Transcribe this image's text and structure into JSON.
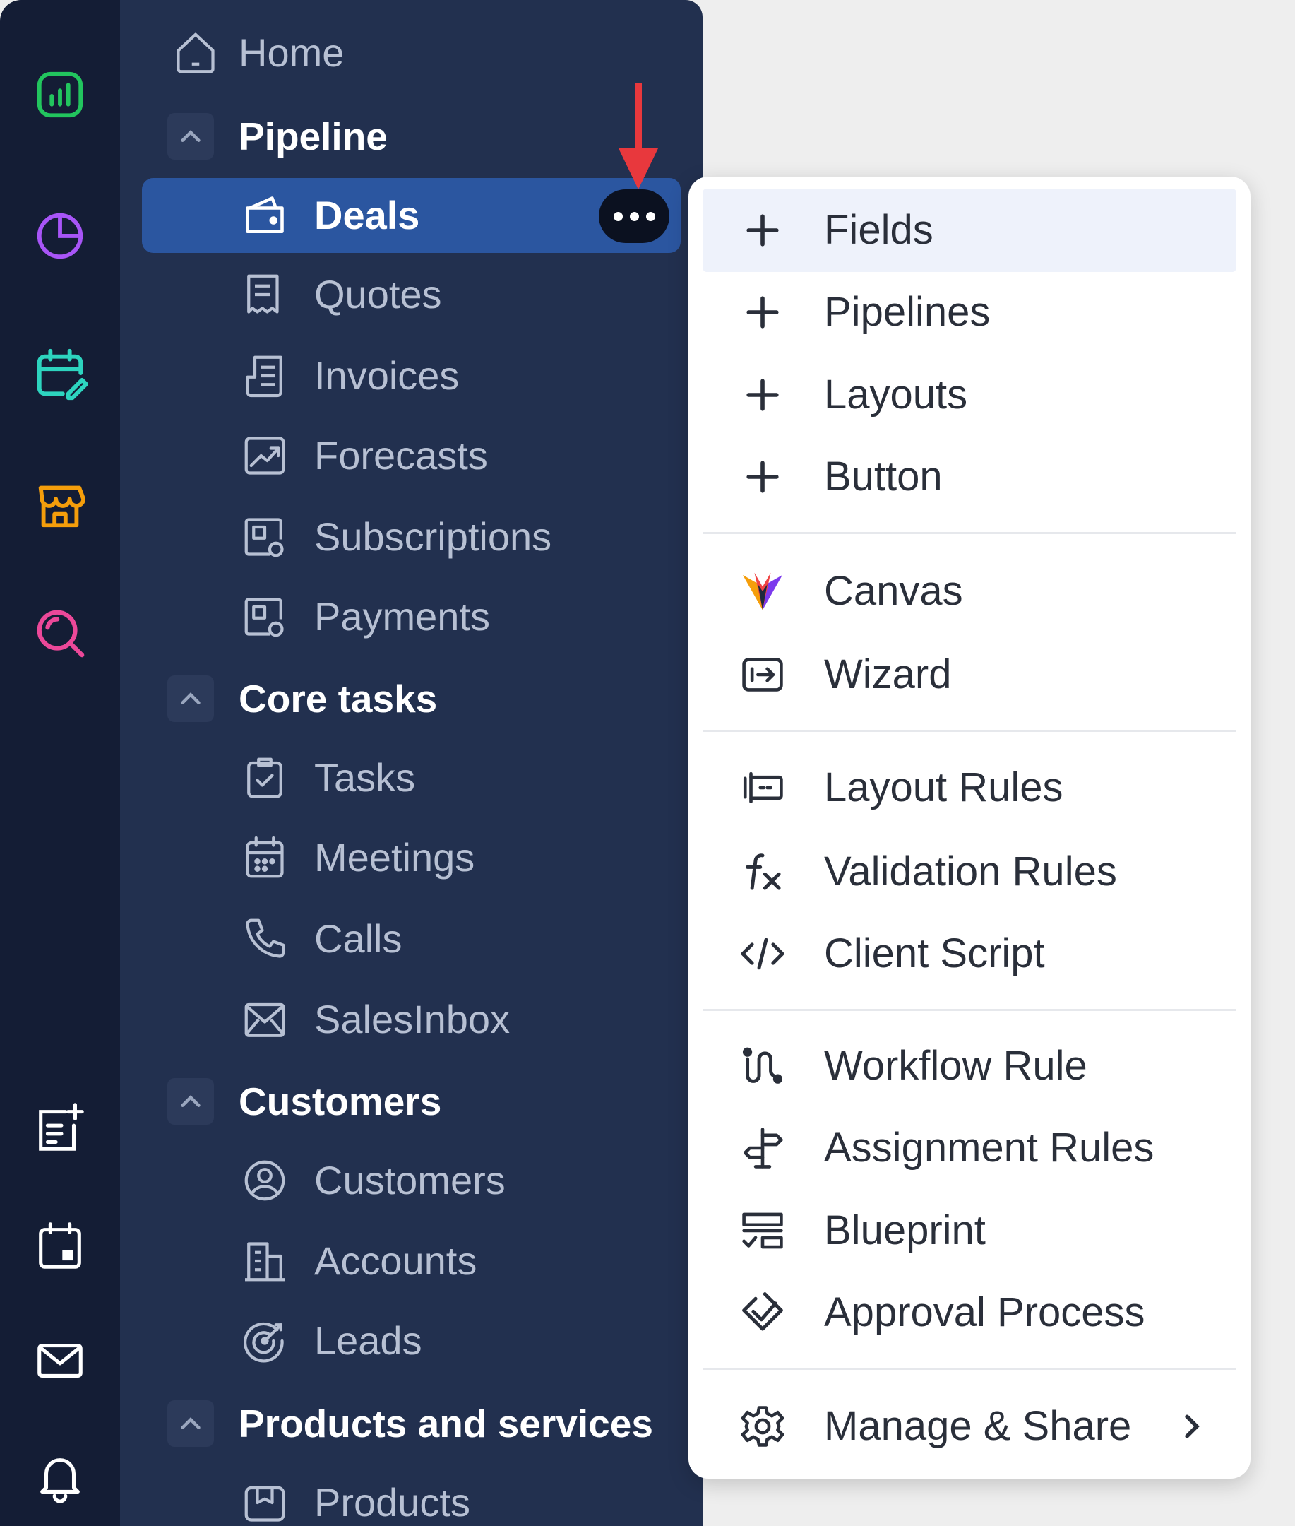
{
  "rail": {
    "icons": [
      "analytics-icon",
      "reports-pie-icon",
      "calendar-edit-icon",
      "store-icon",
      "search-analytics-icon",
      "new-note-icon",
      "calendar-icon",
      "mail-icon",
      "bell-icon"
    ]
  },
  "sidebar": {
    "home": "Home",
    "sections": [
      {
        "title": "Pipeline",
        "items": [
          "Deals",
          "Quotes",
          "Invoices",
          "Forecasts",
          "Subscriptions",
          "Payments"
        ]
      },
      {
        "title": "Core tasks",
        "items": [
          "Tasks",
          "Meetings",
          "Calls",
          "SalesInbox"
        ]
      },
      {
        "title": "Customers",
        "items": [
          "Customers",
          "Accounts",
          "Leads"
        ]
      },
      {
        "title": "Products and services",
        "items": [
          "Products"
        ]
      }
    ]
  },
  "menu": {
    "add_group": [
      "Fields",
      "Pipelines",
      "Layouts",
      "Button"
    ],
    "design_group": [
      "Canvas",
      "Wizard"
    ],
    "rules_group": [
      "Layout Rules",
      "Validation Rules",
      "Client Script"
    ],
    "automation_group": [
      "Workflow Rule",
      "Assignment Rules",
      "Blueprint",
      "Approval Process"
    ],
    "manage": "Manage & Share"
  },
  "colors": {
    "rail_bg": "#141d35",
    "sidebar_bg": "#22304f",
    "selected_bg": "#2b56a0",
    "annotation_arrow": "#e8383d"
  }
}
